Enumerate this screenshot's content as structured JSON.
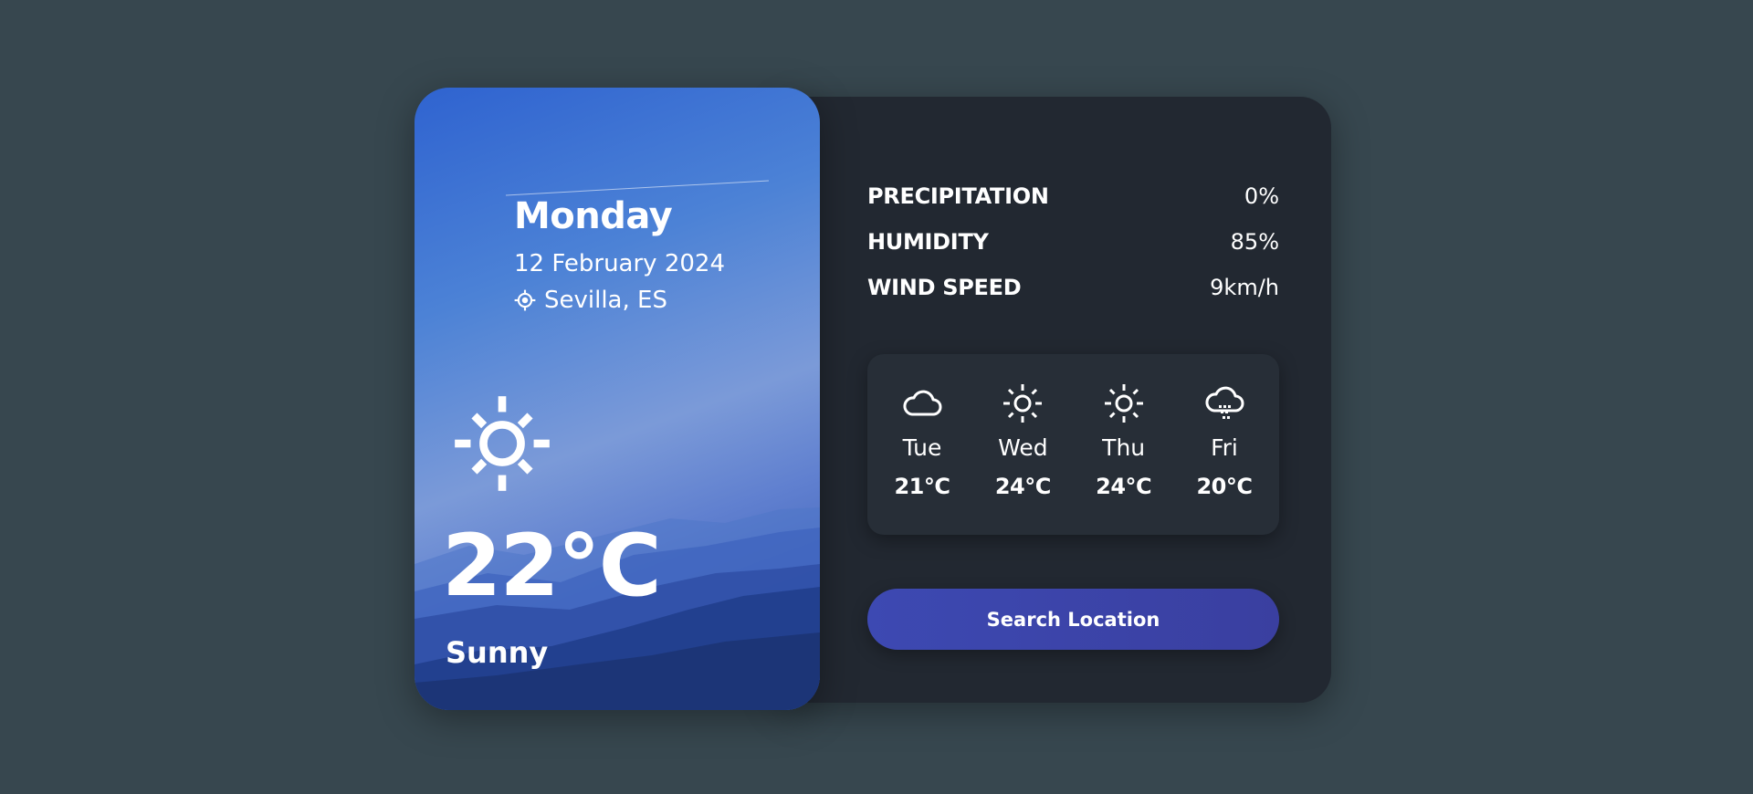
{
  "current": {
    "day": "Monday",
    "date": "12 February 2024",
    "location": "Sevilla, ES",
    "location_icon": "location-crosshair-icon",
    "condition_icon": "sun-icon",
    "temperature": "22°C",
    "condition": "Sunny"
  },
  "stats": [
    {
      "label": "PRECIPITATION",
      "value": "0%"
    },
    {
      "label": "HUMIDITY",
      "value": "85%"
    },
    {
      "label": "WIND SPEED",
      "value": "9km/h"
    }
  ],
  "forecast": [
    {
      "day": "Tue",
      "temp": "21°C",
      "icon": "cloud-icon"
    },
    {
      "day": "Wed",
      "temp": "24°C",
      "icon": "sun-icon"
    },
    {
      "day": "Thu",
      "temp": "24°C",
      "icon": "sun-icon"
    },
    {
      "day": "Fri",
      "temp": "20°C",
      "icon": "cloud-rain-icon"
    }
  ],
  "search_button_label": "Search Location",
  "colors": {
    "page_background": "#37474f",
    "card_background": "#222831",
    "forecast_background": "#272e37",
    "button_background": "#3d49b2",
    "hero_gradient_top": "#2f63d0"
  }
}
